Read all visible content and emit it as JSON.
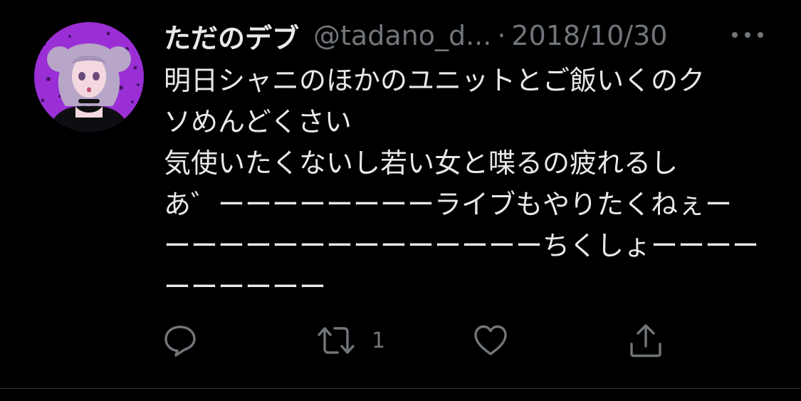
{
  "colors": {
    "background": "#000000",
    "text_primary": "#e7e9ea",
    "text_secondary": "#71767b",
    "avatar_bg": "#9b2fd6"
  },
  "tweet": {
    "display_name": "ただのデブ",
    "handle": "@tadano_d...",
    "separator": "·",
    "date": "2018/10/30",
    "more_icon": "more-dots-icon",
    "avatar_icon": "profile-avatar",
    "lines": [
      "明日シャニのほかのユニットとご飯いくのク",
      "ソめんどくさい",
      "気使いたくないし若い女と喋るの疲れるし",
      "あ゛ーーーーーーーーライブもやりたくねぇー",
      "ーーーーーーーーーーーーーーちくしょーーーー",
      "ーーーーーー"
    ],
    "actions": {
      "reply_icon": "reply-icon",
      "retweet_icon": "retweet-icon",
      "retweet_count": "1",
      "like_icon": "heart-icon",
      "share_icon": "share-icon"
    }
  }
}
